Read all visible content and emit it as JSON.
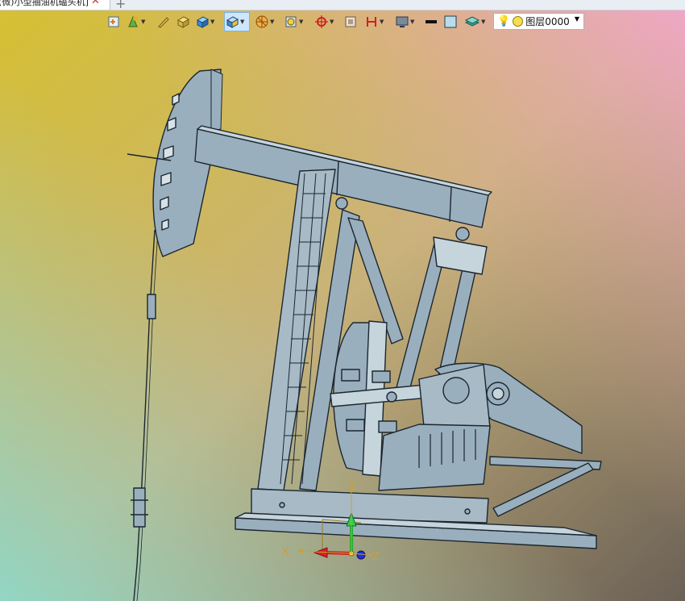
{
  "tab": {
    "title": "(微)小型抽油机磕头机]",
    "close": "✕",
    "new": "+"
  },
  "toolbar": {
    "icons": [
      "save-view-icon",
      "scene-icon",
      "pen-icon",
      "solid-yellow-icon",
      "solid-blue-icon",
      "shaded-view-icon",
      "render-mode-icon",
      "wireframe-icon",
      "snap-icon",
      "mask-icon",
      "section-icon",
      "monitor-icon",
      "line-style-icon",
      "color-swatch-icon",
      "layers-icon"
    ],
    "layer_name": "图层0000",
    "layer_circle_color": "#f4e04a"
  },
  "axes": {
    "x": "X",
    "y": "Y",
    "z": "Z",
    "x_color": "#e02020",
    "y_color": "#20c040",
    "z_color": "#2030d0"
  },
  "model": {
    "name": "pumpjack",
    "fill": "#9aafbd",
    "stroke": "#1b2630"
  },
  "background": {
    "top_left": "#d8c23a",
    "top_right": "#f0a8c8",
    "bottom_left": "#8ed6c8",
    "bottom_right": "#6e6458"
  }
}
